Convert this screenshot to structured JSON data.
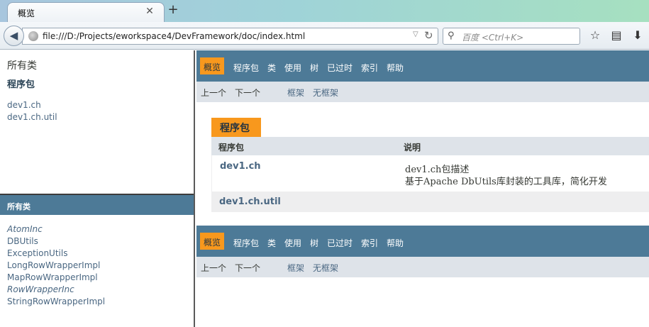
{
  "browser": {
    "tab_title": "概览",
    "tab_close": "✕",
    "new_tab": "+",
    "url": "file:///D:/Projects/eworkspace4/DevFramework/doc/index.html",
    "search_placeholder": "百度 <Ctrl+K>"
  },
  "left_frame": {
    "all_classes_link": "所有类",
    "packages_heading": "程序包",
    "packages": [
      "dev1.ch",
      "dev1.ch.util"
    ],
    "classes_bar_label": "所有类",
    "classes": [
      {
        "name": "AtomInc",
        "italic": true
      },
      {
        "name": "DBUtils",
        "italic": false
      },
      {
        "name": "ExceptionUtils",
        "italic": false
      },
      {
        "name": "LongRowWrapperImpl",
        "italic": false
      },
      {
        "name": "MapRowWrapperImpl",
        "italic": false
      },
      {
        "name": "RowWrapperInc",
        "italic": true
      },
      {
        "name": "StringRowWrapperImpl",
        "italic": false
      }
    ]
  },
  "main": {
    "nav": {
      "overview": "概览",
      "package": "程序包",
      "class": "类",
      "use": "使用",
      "tree": "树",
      "deprecated": "已过时",
      "index": "索引",
      "help": "帮助"
    },
    "subnav": {
      "prev": "上一个",
      "next": "下一个",
      "frames": "框架",
      "no_frames": "无框架"
    },
    "table": {
      "caption": "程序包",
      "col_package": "程序包",
      "col_description": "说明",
      "rows": [
        {
          "name": "dev1.ch",
          "desc_line1": "dev1.ch包描述",
          "desc_line2": "基于Apache DbUtils库封装的工具库，简化开发"
        },
        {
          "name": "dev1.ch.util",
          "desc_line1": "",
          "desc_line2": ""
        }
      ]
    }
  },
  "colors": {
    "nav_bg": "#4d7a97",
    "nav_active": "#f8981d",
    "subnav_bg": "#dee3e9",
    "link": "#4a6782"
  }
}
